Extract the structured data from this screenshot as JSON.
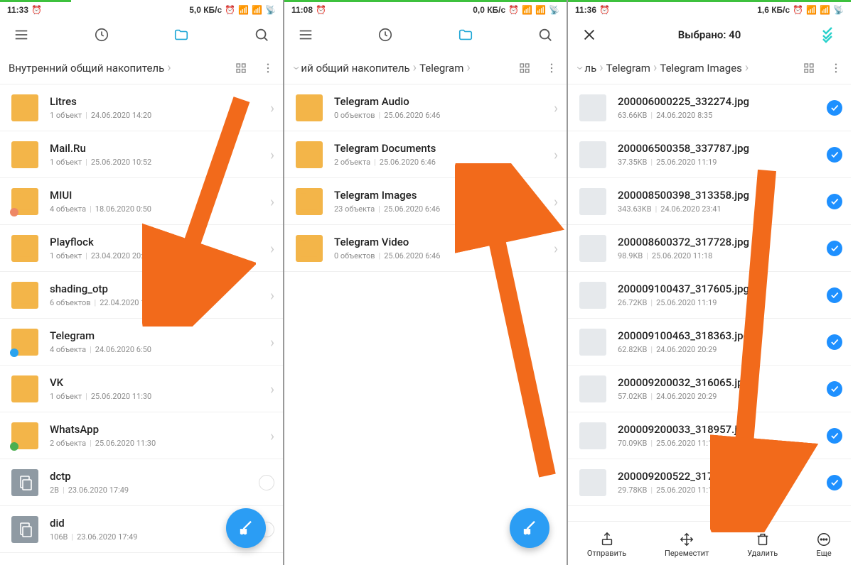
{
  "screens": [
    {
      "time": "11:33",
      "net": "5,0 КБ/с",
      "breadcrumb": [
        "Внутренний общий накопитель"
      ],
      "items": [
        {
          "type": "folder",
          "name": "Litres",
          "meta1": "1 объект",
          "meta2": "24.06.2020 14:20"
        },
        {
          "type": "folder",
          "name": "Mail.Ru",
          "meta1": "1 объект",
          "meta2": "25.06.2020 10:52"
        },
        {
          "type": "folder",
          "name": "MIUI",
          "meta1": "4 объекта",
          "meta2": "18.06.2020 0:50",
          "badge": "#e86"
        },
        {
          "type": "folder",
          "name": "Playflock",
          "meta1": "1 объект",
          "meta2": "23.04.2020 20:27"
        },
        {
          "type": "folder",
          "name": "shading_otp",
          "meta1": "6 объектов",
          "meta2": "22.04.2020 14:09"
        },
        {
          "type": "folder",
          "name": "Telegram",
          "meta1": "4 объекта",
          "meta2": "24.06.2020 6:50",
          "badge": "#2aa3ef"
        },
        {
          "type": "folder",
          "name": "VK",
          "meta1": "1 объект",
          "meta2": "25.06.2020 11:30"
        },
        {
          "type": "folder",
          "name": "WhatsApp",
          "meta1": "2 объекта",
          "meta2": "25.06.2020 11:30",
          "badge": "#4caf50"
        },
        {
          "type": "file",
          "name": "dctp",
          "meta1": "2B",
          "meta2": "23.06.2020 17:49"
        },
        {
          "type": "file",
          "name": "did",
          "meta1": "106B",
          "meta2": "23.06.2020 17:49"
        }
      ]
    },
    {
      "time": "11:08",
      "net": "0,0 КБ/с",
      "breadcrumb": [
        "ий общий накопитель",
        "Telegram"
      ],
      "items": [
        {
          "type": "folder",
          "name": "Telegram Audio",
          "meta1": "0 объектов",
          "meta2": "25.06.2020 6:46"
        },
        {
          "type": "folder",
          "name": "Telegram Documents",
          "meta1": "2 объекта",
          "meta2": "25.06.2020 6:46"
        },
        {
          "type": "folder",
          "name": "Telegram Images",
          "meta1": "23 объекта",
          "meta2": "25.06.2020 6:46"
        },
        {
          "type": "folder",
          "name": "Telegram Video",
          "meta1": "0 объектов",
          "meta2": "25.06.2020 6:46"
        }
      ]
    },
    {
      "time": "11:36",
      "net": "1,6 КБ/с",
      "title": "Выбрано: 40",
      "breadcrumb": [
        "ль",
        "Telegram",
        "Telegram Images"
      ],
      "items": [
        {
          "type": "image",
          "name": "200006000225_332274.jpg",
          "meta1": "63.66KB",
          "meta2": "24.06.2020 8:35"
        },
        {
          "type": "image",
          "name": "200006500358_337787.jpg",
          "meta1": "37.35KB",
          "meta2": "25.06.2020 11:19"
        },
        {
          "type": "image",
          "name": "200008500398_313358.jpg",
          "meta1": "343.63KB",
          "meta2": "24.06.2020 23:41"
        },
        {
          "type": "image",
          "name": "200008600372_317728.jpg",
          "meta1": "98.9KB",
          "meta2": "25.06.2020 11:18"
        },
        {
          "type": "image",
          "name": "200009100437_317605.jpg",
          "meta1": "26.72KB",
          "meta2": "25.06.2020 11:19"
        },
        {
          "type": "image",
          "name": "200009100463_318363.jpg",
          "meta1": "62.82KB",
          "meta2": "24.06.2020 20:29"
        },
        {
          "type": "image",
          "name": "200009200032_316065.jpg",
          "meta1": "57.02KB",
          "meta2": "24.06.2020 20:29"
        },
        {
          "type": "image",
          "name": "200009200033_318957.jpg",
          "meta1": "70.09KB",
          "meta2": "25.06.2020 11:19"
        },
        {
          "type": "image",
          "name": "200009200522_317...",
          "meta1": "29.78KB",
          "meta2": "25.06.2020 11:18"
        }
      ],
      "actions": [
        {
          "label": "Отправить",
          "icon": "share"
        },
        {
          "label": "Переместит",
          "icon": "move"
        },
        {
          "label": "Удалить",
          "icon": "trash"
        },
        {
          "label": "Еще",
          "icon": "more"
        }
      ]
    }
  ]
}
